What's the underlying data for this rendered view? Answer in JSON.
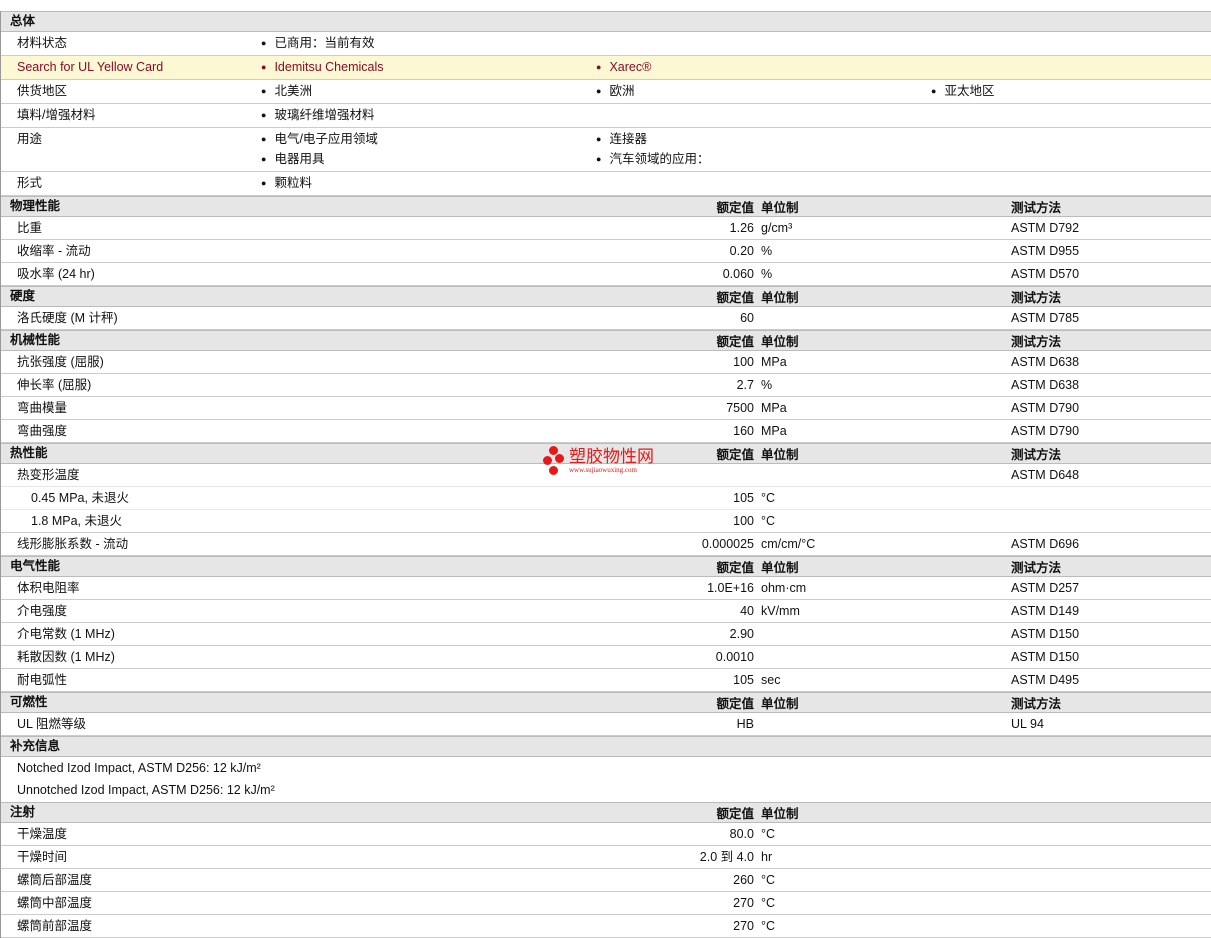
{
  "general": {
    "title": "总体",
    "rows": [
      {
        "label": "材料状态",
        "items": [
          "已商用：当前有效"
        ]
      },
      {
        "label": "Search for UL Yellow Card",
        "items": [
          "Idemitsu Chemicals",
          "Xarec®"
        ],
        "link": true
      },
      {
        "label": "供货地区",
        "items": [
          "北美洲",
          "欧洲",
          "亚太地区"
        ]
      },
      {
        "label": "填料/增强材料",
        "items": [
          "玻璃纤维增强材料"
        ]
      },
      {
        "label": "用途",
        "items": [
          "电气/电子应用领域",
          "连接器",
          "电器用具",
          "汽车领域的应用："
        ]
      },
      {
        "label": "形式",
        "items": [
          "颗粒料"
        ]
      }
    ]
  },
  "sections": [
    {
      "title": "物理性能",
      "h_value": "额定值",
      "h_unit": "单位制",
      "h_test": "测试方法",
      "rows": [
        {
          "label": "比重",
          "value": "1.26",
          "unit": "g/cm³",
          "test": "ASTM D792"
        },
        {
          "label": "收缩率  - 流动",
          "value": "0.20",
          "unit": "%",
          "test": "ASTM D955"
        },
        {
          "label": "吸水率  (24 hr)",
          "value": "0.060",
          "unit": "%",
          "test": "ASTM D570"
        }
      ]
    },
    {
      "title": "硬度",
      "h_value": "额定值",
      "h_unit": "单位制",
      "h_test": "测试方法",
      "rows": [
        {
          "label": "洛氏硬度  (M 计秤)",
          "value": "60",
          "unit": "",
          "test": "ASTM D785"
        }
      ]
    },
    {
      "title": "机械性能",
      "h_value": "额定值",
      "h_unit": "单位制",
      "h_test": "测试方法",
      "rows": [
        {
          "label": "抗张强度  (屈服)",
          "value": "100",
          "unit": "MPa",
          "test": "ASTM D638"
        },
        {
          "label": "伸长率  (屈服)",
          "value": "2.7",
          "unit": "%",
          "test": "ASTM D638"
        },
        {
          "label": "弯曲模量",
          "value": "7500",
          "unit": "MPa",
          "test": "ASTM D790"
        },
        {
          "label": "弯曲强度",
          "value": "160",
          "unit": "MPa",
          "test": "ASTM D790"
        }
      ]
    },
    {
      "title": "热性能",
      "h_value": "额定值",
      "h_unit": "单位制",
      "h_test": "测试方法",
      "rows": [
        {
          "label": "热变形温度",
          "value": "",
          "unit": "",
          "test": "ASTM D648",
          "sub": true
        },
        {
          "label": "0.45 MPa, 未退火",
          "value": "105",
          "unit": "°C",
          "test": "",
          "indent": true,
          "sub": true
        },
        {
          "label": "1.8 MPa, 未退火",
          "value": "100",
          "unit": "°C",
          "test": "",
          "indent": true
        },
        {
          "label": "线形膨胀系数  - 流动",
          "value": "0.000025",
          "unit": "cm/cm/°C",
          "test": "ASTM D696"
        }
      ]
    },
    {
      "title": "电气性能",
      "h_value": "额定值",
      "h_unit": "单位制",
      "h_test": "测试方法",
      "rows": [
        {
          "label": "体积电阻率",
          "value": "1.0E+16",
          "unit": "ohm·cm",
          "test": "ASTM D257"
        },
        {
          "label": "介电强度",
          "value": "40",
          "unit": "kV/mm",
          "test": "ASTM D149"
        },
        {
          "label": "介电常数  (1 MHz)",
          "value": "2.90",
          "unit": "",
          "test": "ASTM D150"
        },
        {
          "label": "耗散因数  (1 MHz)",
          "value": "0.0010",
          "unit": "",
          "test": "ASTM D150"
        },
        {
          "label": "耐电弧性",
          "value": "105",
          "unit": "sec",
          "test": "ASTM D495"
        }
      ]
    },
    {
      "title": "可燃性",
      "h_value": "额定值",
      "h_unit": "单位制",
      "h_test": "测试方法",
      "rows": [
        {
          "label": "UL 阻燃等级",
          "value": "HB",
          "unit": "",
          "test": "UL 94"
        }
      ]
    },
    {
      "title": "补充信息",
      "notes": [
        "Notched Izod Impact, ASTM D256: 12 kJ/m²",
        "Unnotched Izod Impact, ASTM D256: 12 kJ/m²"
      ]
    },
    {
      "title": "注射",
      "h_value": "额定值",
      "h_unit": "单位制",
      "h_test": "",
      "rows": [
        {
          "label": "干燥温度",
          "value": "80.0",
          "unit": "°C",
          "test": ""
        },
        {
          "label": "干燥时间",
          "value": "2.0 到  4.0",
          "unit": "hr",
          "test": ""
        },
        {
          "label": "螺筒后部温度",
          "value": "260",
          "unit": "°C",
          "test": ""
        },
        {
          "label": "螺筒中部温度",
          "value": "270",
          "unit": "°C",
          "test": ""
        },
        {
          "label": "螺筒前部温度",
          "value": "270",
          "unit": "°C",
          "test": ""
        }
      ]
    }
  ],
  "watermark": {
    "name": "塑胶物性网",
    "url": "www.sujiaowuxing.com"
  }
}
